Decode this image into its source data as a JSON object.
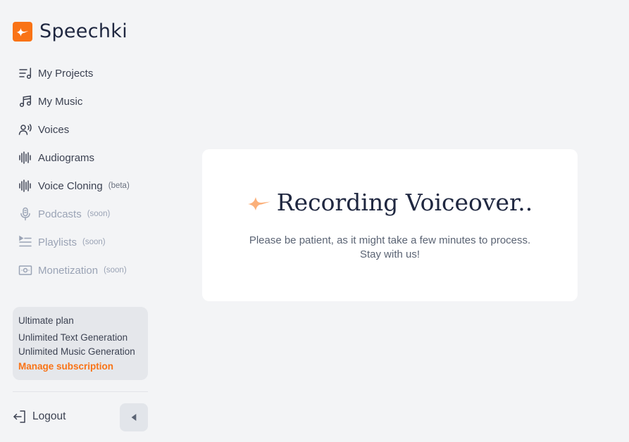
{
  "brand": {
    "name": "Speechki",
    "accent": "#f97316"
  },
  "nav": [
    {
      "label": "My Projects",
      "icon": "projects-list-icon",
      "tag": "",
      "disabled": false
    },
    {
      "label": "My Music",
      "icon": "music-note-icon",
      "tag": "",
      "disabled": false
    },
    {
      "label": "Voices",
      "icon": "voice-user-icon",
      "tag": "",
      "disabled": false
    },
    {
      "label": "Audiograms",
      "icon": "waveform-icon",
      "tag": "",
      "disabled": false
    },
    {
      "label": "Voice Cloning",
      "icon": "waveform-icon",
      "tag": "(beta)",
      "disabled": false
    },
    {
      "label": "Podcasts",
      "icon": "microphone-icon",
      "tag": "(soon)",
      "disabled": true
    },
    {
      "label": "Playlists",
      "icon": "playlist-icon",
      "tag": "(soon)",
      "disabled": true
    },
    {
      "label": "Monetization",
      "icon": "money-icon",
      "tag": "(soon)",
      "disabled": true
    }
  ],
  "plan": {
    "name": "Ultimate plan",
    "feature_1": "Unlimited Text Generation",
    "feature_2": "Unlimited Music Generation",
    "manage_label": "Manage subscription"
  },
  "logout_label": "Logout",
  "main": {
    "title": "Recording Voiceover..",
    "subtitle_line1": "Please be patient, as it might take a few minutes to process.",
    "subtitle_line2": "Stay with us!"
  }
}
